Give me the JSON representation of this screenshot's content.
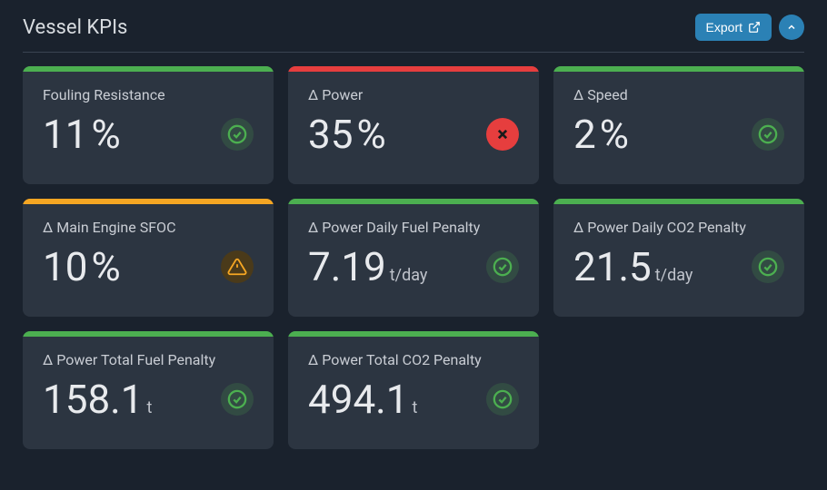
{
  "header": {
    "title": "Vessel KPIs",
    "export_label": "Export"
  },
  "colors": {
    "ok": "#4caf50",
    "error": "#e63e3e",
    "warn": "#f5a623"
  },
  "cards": [
    {
      "label": "Fouling Resistance",
      "value": "11",
      "unit": "%",
      "status": "ok",
      "stripe": "#4caf50"
    },
    {
      "label": "Δ Power",
      "value": "35",
      "unit": "%",
      "status": "error",
      "stripe": "#e63e3e"
    },
    {
      "label": "Δ Speed",
      "value": "2",
      "unit": "%",
      "status": "ok",
      "stripe": "#4caf50"
    },
    {
      "label": "Δ Main Engine SFOC",
      "value": "10",
      "unit": "%",
      "status": "warn",
      "stripe": "#f5a623"
    },
    {
      "label": "Δ Power Daily Fuel Penalty",
      "value": "7.19",
      "unit": "t/day",
      "status": "ok",
      "stripe": "#4caf50"
    },
    {
      "label": "Δ Power Daily CO2 Penalty",
      "value": "21.5",
      "unit": "t/day",
      "status": "ok",
      "stripe": "#4caf50"
    },
    {
      "label": "Δ Power Total Fuel Penalty",
      "value": "158.1",
      "unit": "t",
      "status": "ok",
      "stripe": "#4caf50"
    },
    {
      "label": "Δ Power Total CO2 Penalty",
      "value": "494.1",
      "unit": "t",
      "status": "ok",
      "stripe": "#4caf50"
    }
  ]
}
